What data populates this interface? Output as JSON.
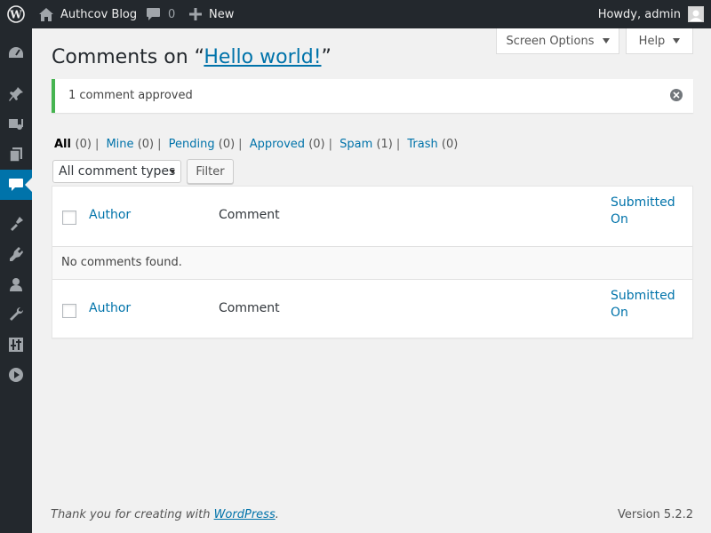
{
  "adminbar": {
    "site_name": "Authcov Blog",
    "comment_count": "0",
    "new_label": "New",
    "howdy": "Howdy, admin"
  },
  "sidebar": {
    "items": [
      "dashboard-icon",
      "posts-icon",
      "media-icon",
      "pages-icon",
      "comments-icon",
      "appearance-icon",
      "plugins-icon",
      "users-icon",
      "tools-icon",
      "settings-icon",
      "collapse-icon"
    ],
    "active": "comments-icon"
  },
  "screen_meta": {
    "screen_options": "Screen Options",
    "help": "Help"
  },
  "heading": {
    "prefix": "Comments on “",
    "post_link": "Hello world!",
    "suffix": "”"
  },
  "notice": {
    "text": "1 comment approved"
  },
  "filters": [
    {
      "label": "All",
      "count": "(0)"
    },
    {
      "label": "Mine",
      "count": "(0)"
    },
    {
      "label": "Pending",
      "count": "(0)"
    },
    {
      "label": "Approved",
      "count": "(0)"
    },
    {
      "label": "Spam",
      "count": "(1)"
    },
    {
      "label": "Trash",
      "count": "(0)"
    }
  ],
  "actions": {
    "comment_type_select": "All comment types",
    "filter_button": "Filter"
  },
  "table": {
    "columns": {
      "author": "Author",
      "comment": "Comment",
      "submitted_on_line1": "Submitted",
      "submitted_on_line2": "On"
    },
    "no_items": "No comments found."
  },
  "footer": {
    "thanks_prefix": "Thank you for creating with ",
    "thanks_link": "WordPress",
    "thanks_suffix": ".",
    "version": "Version 5.2.2"
  },
  "colors": {
    "adminbar_bg": "#23282d",
    "accent": "#0073aa",
    "notice_success": "#46b450",
    "page_bg": "#f1f1f1"
  }
}
